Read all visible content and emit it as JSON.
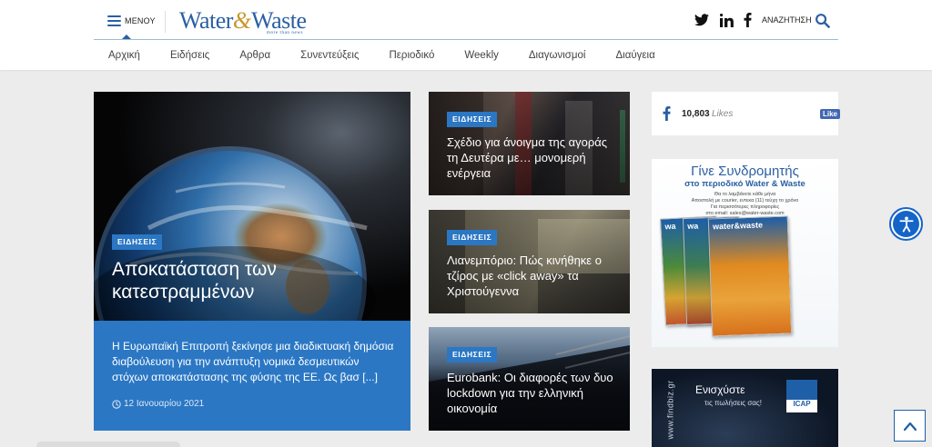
{
  "header": {
    "menu_label": "ΜΕΝΟΥ",
    "logo_part1": "Water",
    "logo_amp": "&",
    "logo_part2": "Waste",
    "logo_tagline": "more than news",
    "search_label": "ΑΝΑΖΗΤΗΣΗ",
    "brand_color": "#2a5fa3",
    "accent_color": "#c8972f"
  },
  "nav": {
    "items": [
      {
        "label": "Αρχική"
      },
      {
        "label": "Ειδήσεις"
      },
      {
        "label": "Αρθρα"
      },
      {
        "label": "Συνεντεύξεις"
      },
      {
        "label": "Περιοδικό"
      },
      {
        "label": "Weekly"
      },
      {
        "label": "Διαγωνισμοί"
      },
      {
        "label": "Διαύγεια"
      }
    ]
  },
  "feature": {
    "badge": "ΕΙΔΗΣΕΙΣ",
    "title": "Αποκατάσταση των κατεστραμμένων",
    "excerpt": "Η Ευρωπαϊκή Επιτροπή ξεκίνησε μια διαδικτυακή δημόσια διαβούλευση για την ανάπτυξη νομικά δεσμευτικών στόχων αποκατάστασης της φύσης της ΕΕ. Ως βασ [...]",
    "date": "12 Ιανουαρίου 2021",
    "badge_color": "#2b77c4"
  },
  "cards": [
    {
      "badge": "ΕΙΔΗΣΕΙΣ",
      "title": "Σχέδιο για άνοιγμα της αγοράς τη Δευτέρα με… μονομερή ενέργεια"
    },
    {
      "badge": "ΕΙΔΗΣΕΙΣ",
      "title": "Λιανεμπόριο: Πώς κινήθηκε ο τζίρος με «click away» τα Χριστούγεννα"
    },
    {
      "badge": "ΕΙΔΗΣΕΙΣ",
      "title": "Eurobank: Οι διαφορές των δυο lockdown για την ελληνική οικονομία"
    }
  ],
  "facebook": {
    "count": "10,803",
    "likes_label": "Likes",
    "like_button": "Like"
  },
  "ad_subscription": {
    "title": "Γίνε Συνδρομητής",
    "subtitle": "στο περιοδικό Water & Waste",
    "line1": "Θα το λαμβάνετε κάθε μήνα",
    "line2": "Αποστολή με courier, εντεκα (11) τεύχη το χρόνο",
    "line3": "Για περισσότερες πληροφορίες",
    "line4": "στο email: sales@water-waste.com",
    "mag_label": "water&waste"
  },
  "ad_findbiz": {
    "url": "www.findbiz.gr",
    "line1": "Ενισχύστε",
    "line2": "τις πωλήσεις σας!",
    "logo": "ICAP",
    "logo_sub": "GROUP"
  }
}
